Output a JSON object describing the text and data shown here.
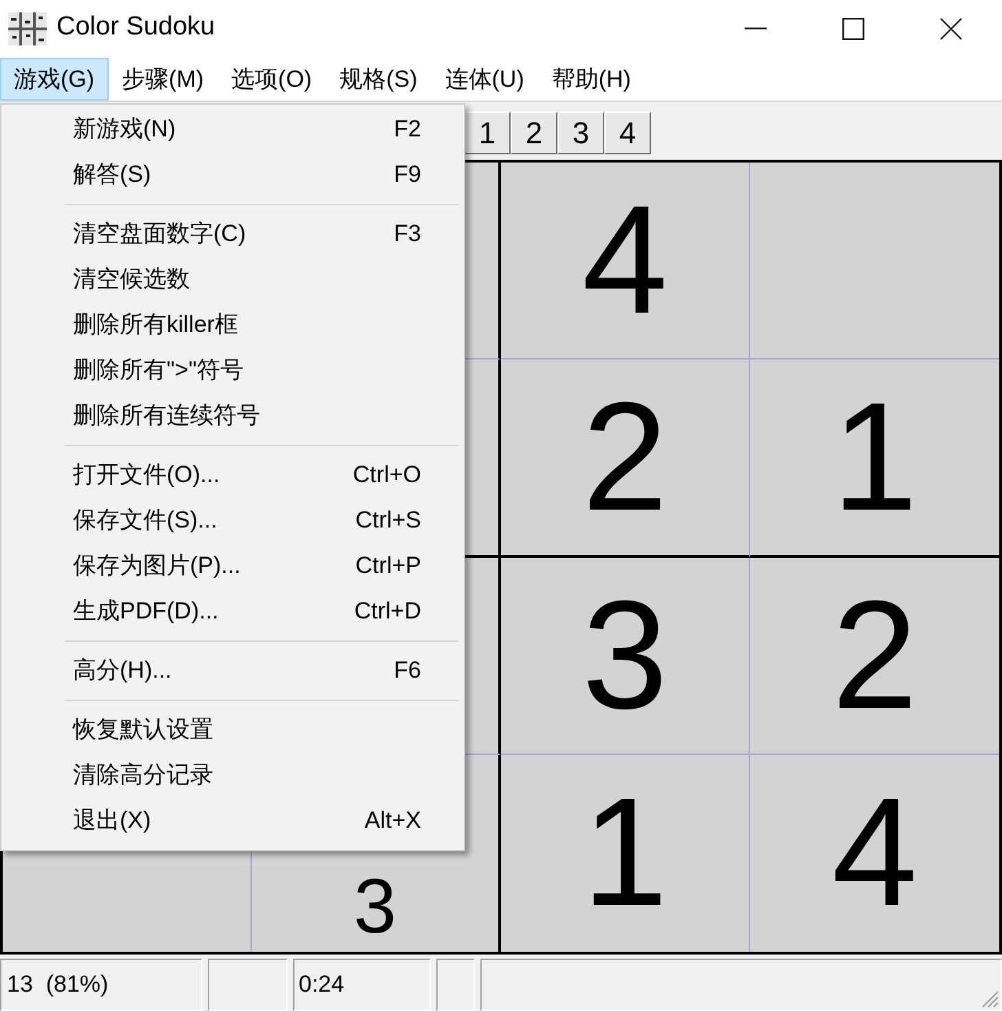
{
  "window": {
    "title": "Color Sudoku"
  },
  "menu_bar": [
    {
      "label": "游戏(G)",
      "selected": true
    },
    {
      "label": "步骤(M)",
      "selected": false
    },
    {
      "label": "选项(O)",
      "selected": false
    },
    {
      "label": "规格(S)",
      "selected": false
    },
    {
      "label": "连体(U)",
      "selected": false
    },
    {
      "label": "帮助(H)",
      "selected": false
    }
  ],
  "open_menu": {
    "items": [
      {
        "kind": "item",
        "label": "新游戏(N)",
        "shortcut": "F2"
      },
      {
        "kind": "item",
        "label": "解答(S)",
        "shortcut": "F9"
      },
      {
        "kind": "separator"
      },
      {
        "kind": "item",
        "label": "清空盘面数字(C)",
        "shortcut": "F3"
      },
      {
        "kind": "item",
        "label": "清空候选数"
      },
      {
        "kind": "item",
        "label": "删除所有killer框"
      },
      {
        "kind": "item",
        "label": "删除所有\">\"符号"
      },
      {
        "kind": "item",
        "label": "删除所有连续符号"
      },
      {
        "kind": "separator"
      },
      {
        "kind": "item",
        "label": "打开文件(O)...",
        "shortcut": "Ctrl+O"
      },
      {
        "kind": "item",
        "label": "保存文件(S)...",
        "shortcut": "Ctrl+S"
      },
      {
        "kind": "item",
        "label": "保存为图片(P)...",
        "shortcut": "Ctrl+P"
      },
      {
        "kind": "item",
        "label": "生成PDF(D)...",
        "shortcut": "Ctrl+D"
      },
      {
        "kind": "separator"
      },
      {
        "kind": "item",
        "label": "高分(H)...",
        "shortcut": "F6"
      },
      {
        "kind": "separator"
      },
      {
        "kind": "item",
        "label": "恢复默认设置"
      },
      {
        "kind": "item",
        "label": "清除高分记录"
      },
      {
        "kind": "item",
        "label": "退出(X)",
        "shortcut": "Alt+X"
      }
    ]
  },
  "toolbar": {
    "digit_buttons": [
      "1",
      "2",
      "3",
      "4"
    ]
  },
  "board": {
    "rows": [
      [
        null,
        null,
        "4",
        null
      ],
      [
        null,
        null,
        "2",
        "1"
      ],
      [
        null,
        null,
        "3",
        "2"
      ],
      [
        null,
        "3",
        "1",
        "4"
      ]
    ]
  },
  "status_bar": {
    "panel_1": "13  (81%)",
    "timer": "0:24"
  }
}
